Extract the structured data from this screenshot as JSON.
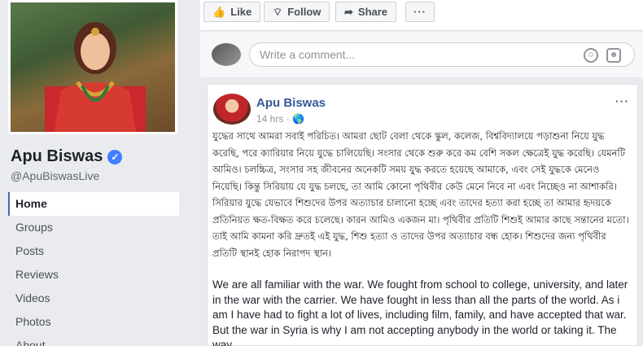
{
  "page": {
    "name": "Apu Biswas",
    "handle": "@ApuBiswasLive",
    "verified_icon": "check-badge-icon"
  },
  "nav": {
    "items": [
      {
        "label": "Home",
        "active": true
      },
      {
        "label": "Groups",
        "active": false
      },
      {
        "label": "Posts",
        "active": false
      },
      {
        "label": "Reviews",
        "active": false
      },
      {
        "label": "Videos",
        "active": false
      },
      {
        "label": "Photos",
        "active": false
      },
      {
        "label": "About",
        "active": false
      }
    ]
  },
  "actions": {
    "like": "Like",
    "follow": "Follow",
    "share": "Share",
    "more": "···"
  },
  "comment": {
    "placeholder": "Write a comment..."
  },
  "post": {
    "author": "Apu Biswas",
    "time": "14 hrs ·",
    "menu": "···",
    "bengali_text": "যুদ্ধের সাথে আমরা সবাই পরিচিত। আমরা ছোট বেলা থেকে স্কুল, কলেজ, বিশ্ববিদ্যালয়ে পড়াশুনা নিয়ে যুদ্ধ করেছি, পরে ক্যারিয়ার নিয়ে যুদ্ধে চালিয়েছি। সংসার থেকে শুরু করে কম বেশি সকল ক্ষেত্রেই যুদ্ধ করেছি। যেমনটি আমিও। চলচ্চিত্র, সংসার সহ জীবনের অনেকটি সময় যুদ্ধ করতে হয়েছে আমাকে, এবং সেই যুদ্ধকে মেনেও নিয়েছি। কিন্তু সিরিয়ায় যে যুদ্ধ চলছে, তা আমি কোনো পৃথিবীর কেউ মেনে নিবে না এবং নিচ্ছেও না আশাকরি। সিরিয়ার যুদ্ধে যেভাবে শিশুদের উপর অত্যাচার চালানো হচ্ছে এবং তাদের হত্যা করা হচ্ছে তা আমার হৃদয়কে প্রতিনিয়ত ক্ষত-বিক্ষত করে চলেছে। কারন আমিও একজন মা। পৃথিবীর প্রতিটি শিশুই আমার কাছে সন্তানের মতো। তাই আমি কামনা করি দ্রুতই এই যুদ্ধ, শিশু হত্যা ও তাদের উপর অত্যাচার বন্ধ হোক। শিশুদের জন্য পৃথিবীর প্রতিটি স্থানই হোক নিরাপদ স্থান।",
    "english_text": "We are all familiar with the war. We fought from school to college, university, and later in the war with the carrier. We have fought in less than all the parts of the world. As i am I have had to fight a lot of lives, including film, family, and have accepted that war. But the war in Syria is why I am not accepting anybody in the world or taking it. The way"
  }
}
